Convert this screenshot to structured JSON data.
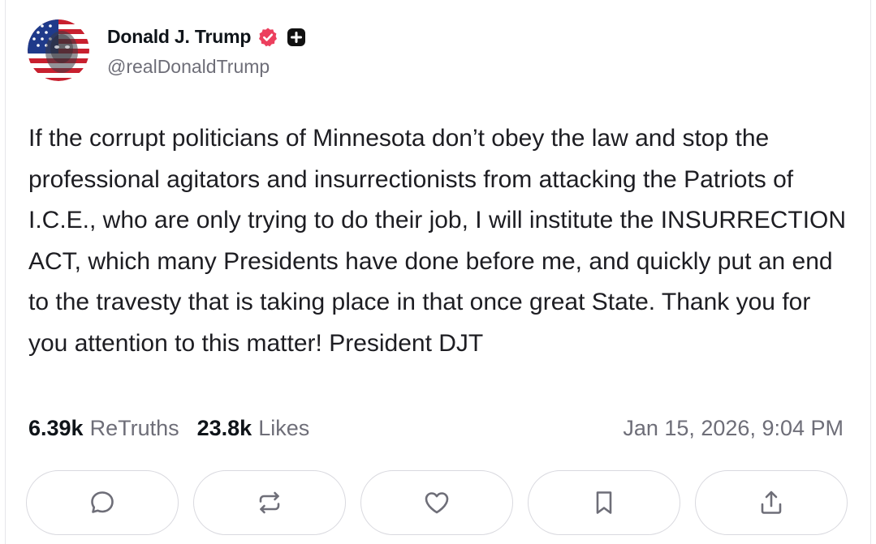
{
  "post": {
    "author": {
      "display_name": "Donald J. Trump",
      "handle": "@realDonaldTrump",
      "verified_badge_color": "#ec3f5d",
      "plus_badge_color": "#111111",
      "avatar_icon": "flag-portrait-avatar"
    },
    "body": "If the corrupt politicians of Minnesota don’t obey the law and stop the professional agitators and insurrectionists from attacking the Patriots of I.C.E., who are only trying to do their job, I will institute the INSURRECTION ACT, which many Presidents have done before me, and quickly put an end to the travesty that is taking place in that once great State. Thank you for you attention to this matter! President DJT",
    "stats": {
      "retruths_count": "6.39k",
      "retruths_label": "ReTruths",
      "likes_count": "23.8k",
      "likes_label": "Likes"
    },
    "timestamp": "Jan 15, 2026, 9:04 PM",
    "actions": [
      {
        "name": "reply",
        "icon": "comment-icon"
      },
      {
        "name": "retruth",
        "icon": "repost-icon"
      },
      {
        "name": "like",
        "icon": "heart-icon"
      },
      {
        "name": "bookmark",
        "icon": "bookmark-icon"
      },
      {
        "name": "share",
        "icon": "share-icon"
      }
    ],
    "colors": {
      "text_primary": "#0f1419",
      "text_secondary": "#6e6e78",
      "border": "#d9d9df",
      "icon": "#6e6e78"
    }
  }
}
